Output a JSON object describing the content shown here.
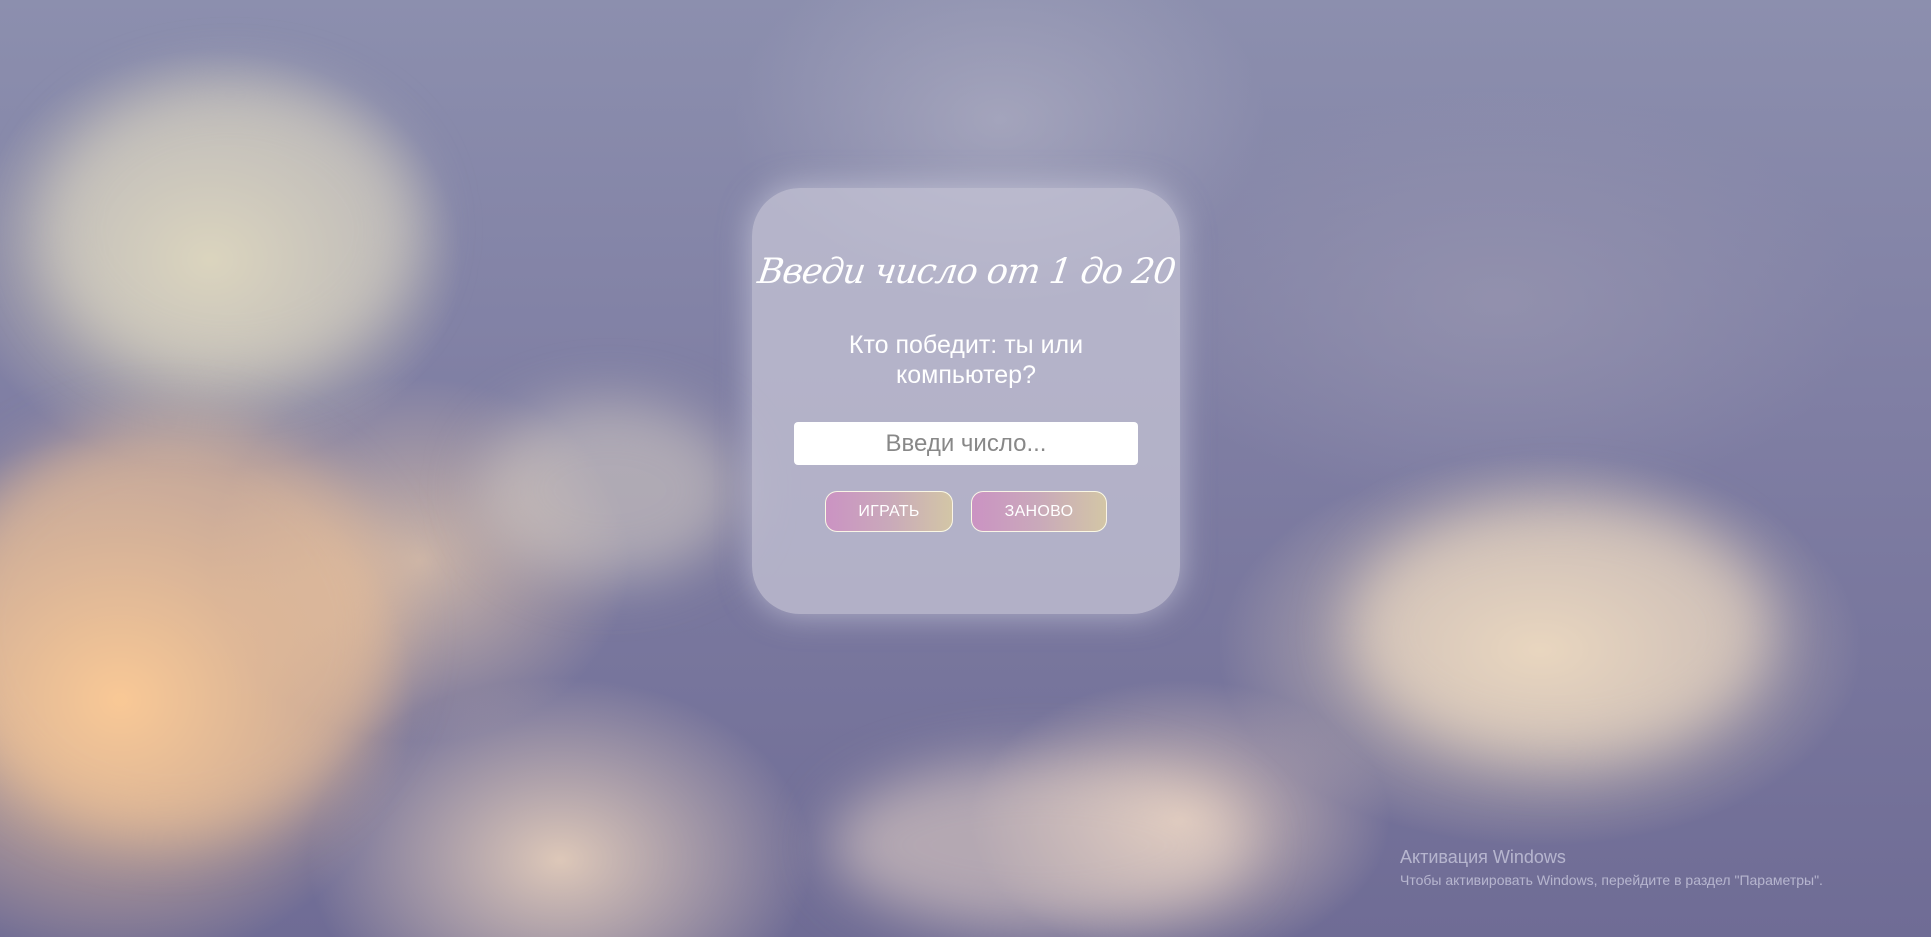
{
  "game": {
    "title": "Введи число от 1 до 20",
    "subtitle": "Кто победит: ты или компьютер?",
    "input_placeholder": "Введи число...",
    "play_label": "ИГРАТЬ",
    "reset_label": "ЗАНОВО"
  },
  "watermark": {
    "title": "Активация Windows",
    "text": "Чтобы активировать Windows, перейдите в раздел \"Параметры\"."
  },
  "colors": {
    "button_gradient_start": "#cb93c3",
    "button_gradient_end": "#d3c6a6",
    "card_background": "#c8c6d7",
    "text": "#ffffff"
  }
}
